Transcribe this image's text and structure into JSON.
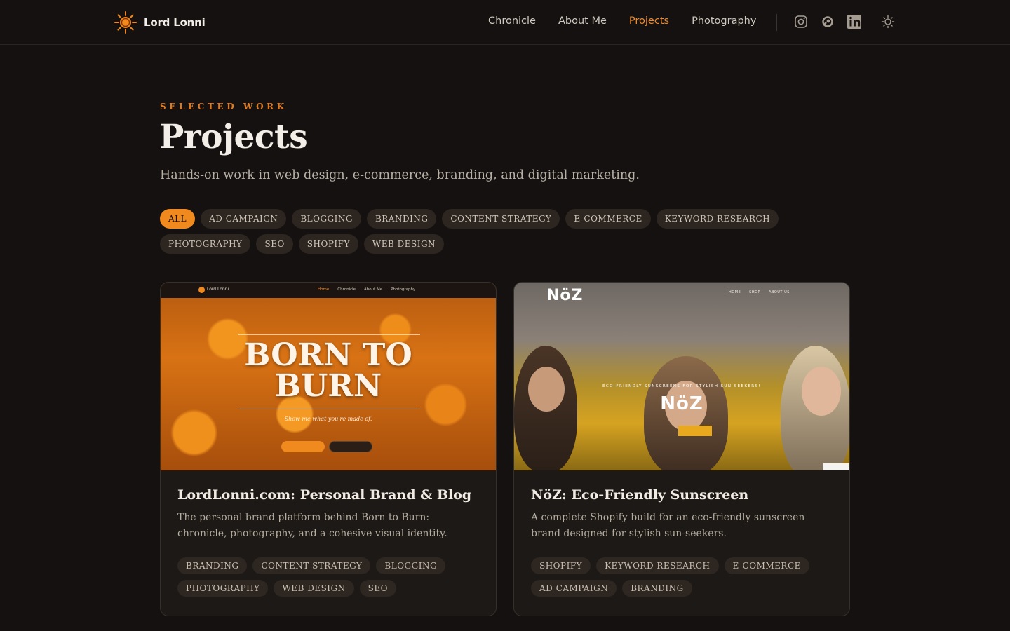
{
  "colors": {
    "accent": "#f08a1e",
    "background": "#141110",
    "card": "#1c1916"
  },
  "header": {
    "brand": "Lord Lonni",
    "nav": [
      {
        "label": "Chronicle",
        "active": false
      },
      {
        "label": "About Me",
        "active": false
      },
      {
        "label": "Projects",
        "active": true
      },
      {
        "label": "Photography",
        "active": false
      }
    ],
    "social_icons": [
      "instagram-icon",
      "flickr-icon",
      "linkedin-icon"
    ],
    "theme_icon": "sun-icon"
  },
  "hero": {
    "eyebrow": "SELECTED WORK",
    "title": "Projects",
    "subtitle": "Hands-on work in web design, e-commerce, branding, and digital marketing."
  },
  "filters": [
    {
      "label": "ALL",
      "active": true
    },
    {
      "label": "AD CAMPAIGN"
    },
    {
      "label": "BLOGGING"
    },
    {
      "label": "BRANDING"
    },
    {
      "label": "CONTENT STRATEGY"
    },
    {
      "label": "E-COMMERCE"
    },
    {
      "label": "KEYWORD RESEARCH"
    },
    {
      "label": "PHOTOGRAPHY"
    },
    {
      "label": "SEO"
    },
    {
      "label": "SHOPIFY"
    },
    {
      "label": "WEB DESIGN"
    }
  ],
  "projects": [
    {
      "title": "LordLonni.com: Personal Brand & Blog",
      "description": "The personal brand platform behind Born to Burn: chronicle, photography, and a cohesive visual identity.",
      "tags": [
        "BRANDING",
        "CONTENT STRATEGY",
        "BLOGGING",
        "PHOTOGRAPHY",
        "WEB DESIGN",
        "SEO"
      ],
      "thumb": {
        "brand": "Lord Lonni",
        "links": [
          "Home",
          "Chronicle",
          "About Me",
          "Photography"
        ],
        "headline_1": "BORN TO",
        "headline_2": "BURN",
        "tagline": "Show me what you're made of."
      }
    },
    {
      "title": "NöZ: Eco-Friendly Sunscreen",
      "description": "A complete Shopify build for an eco-friendly sunscreen brand designed for stylish sun-seekers.",
      "tags": [
        "SHOPIFY",
        "KEYWORD RESEARCH",
        "E-COMMERCE",
        "AD CAMPAIGN",
        "BRANDING"
      ],
      "thumb": {
        "logo": "NöZ",
        "menu": [
          "HOME",
          "SHOP",
          "ABOUT US"
        ],
        "caption": "ECO-FRIENDLY SUNSCREENS FOR STYLISH SUN-SEEKERS!",
        "name": "NöZ"
      }
    }
  ]
}
